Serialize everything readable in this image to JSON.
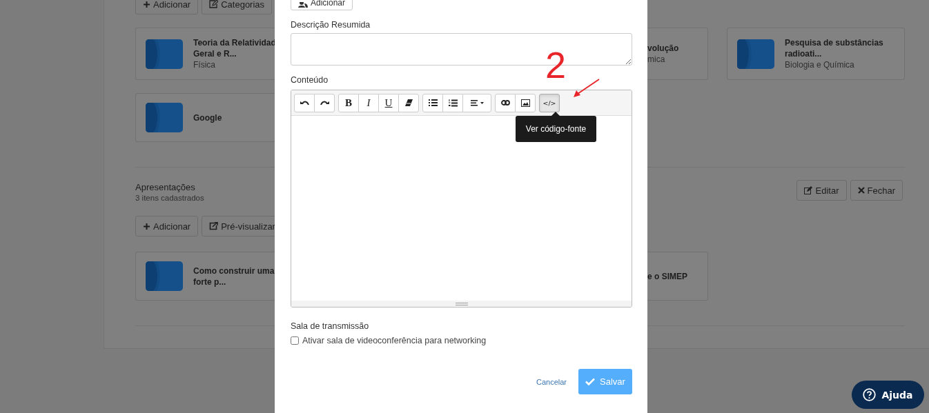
{
  "background": {
    "top_buttons": [
      {
        "label": "Adicionar"
      },
      {
        "label": "Categorias"
      }
    ],
    "card_rows": [
      {
        "left": {
          "title_lines": [
            "Teoria da Relatividad",
            "Geral e R..."
          ],
          "subtitle": "Física"
        },
        "stub": {
          "title_lines": [
            "volução"
          ],
          "subtitle": "mica"
        },
        "right": {
          "title_lines": [
            "Pesquisa de substâncias",
            "radioati..."
          ],
          "subtitle": "Biologia e Química"
        }
      },
      {
        "left": {
          "title_lines": [
            "Google"
          ]
        }
      }
    ],
    "section": {
      "title": "Apresentações",
      "count": "3 itens cadastrados",
      "actions": [
        {
          "label": "Editar"
        },
        {
          "label": "Fechar"
        }
      ],
      "buttons": [
        {
          "label": "Adicionar"
        },
        {
          "label": "Pré-visualizar"
        }
      ],
      "card_rows": [
        {
          "left": {
            "title_lines": [
              "Como construir uma",
              "forte p..."
            ]
          },
          "stub": {
            "title_lines": [
              "e o SIMEP"
            ]
          }
        }
      ]
    }
  },
  "modal": {
    "top_button": {
      "label": "Adicionar"
    },
    "summary_label": "Descrição Resumida",
    "content_label": "Conteúdo",
    "toolbar": [
      [
        {
          "kind": "undo",
          "active": false
        },
        {
          "kind": "redo",
          "active": false
        }
      ],
      [
        {
          "kind": "bold",
          "label": "B",
          "active": false
        },
        {
          "kind": "italic",
          "label": "I",
          "active": false
        },
        {
          "kind": "underline",
          "label": "U",
          "active": false
        },
        {
          "kind": "eraser",
          "active": false
        }
      ],
      [
        {
          "kind": "ul",
          "active": false
        },
        {
          "kind": "ol",
          "active": false
        },
        {
          "kind": "align",
          "active": false
        }
      ],
      [
        {
          "kind": "link",
          "active": false
        },
        {
          "kind": "picture",
          "active": false
        }
      ],
      [
        {
          "kind": "code",
          "label": "</>",
          "active": true
        }
      ]
    ],
    "tooltip": "Ver código-fonte",
    "room_label": "Sala de transmissão",
    "room_checkbox": {
      "label": "Ativar sala de videoconferência para networking",
      "checked": false
    },
    "cancel": "Cancelar",
    "save": "Salvar"
  },
  "annotation": {
    "label": "2"
  },
  "help_button": {
    "label": "Ajuda"
  }
}
